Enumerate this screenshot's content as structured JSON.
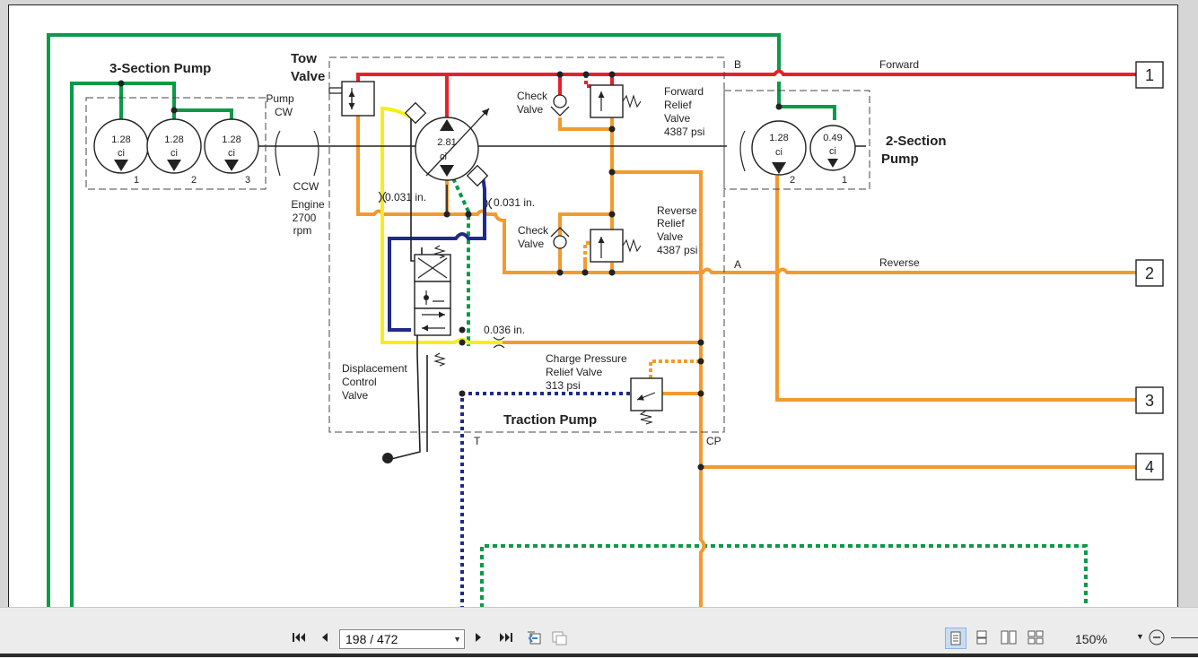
{
  "diagram": {
    "three_section_pump": {
      "title": "3-Section Pump",
      "sections": [
        {
          "value": "1.28",
          "unit": "ci",
          "num": "1"
        },
        {
          "value": "1.28",
          "unit": "ci",
          "num": "2"
        },
        {
          "value": "1.28",
          "unit": "ci",
          "num": "3"
        }
      ],
      "rotation_pump": [
        "Pump",
        "CW"
      ],
      "rotation_engine": [
        "CCW",
        "Engine",
        "2700",
        "rpm"
      ]
    },
    "tow_valve": [
      "Tow",
      "Valve"
    ],
    "traction_pump": {
      "title": "Traction Pump",
      "main": {
        "value": "2.81",
        "unit": "ci"
      },
      "orifice_1": "0.031 in.",
      "orifice_2": "0.031 in.",
      "orifice_3": "0.036 in.",
      "check_valve_1": [
        "Check",
        "Valve"
      ],
      "check_valve_2": [
        "Check",
        "Valve"
      ],
      "forward_relief": [
        "Forward",
        "Relief",
        "Valve",
        "4387 psi"
      ],
      "reverse_relief": [
        "Reverse",
        "Relief",
        "Valve",
        "4387 psi"
      ],
      "charge_relief": [
        "Charge Pressure",
        "Relief Valve",
        "313 psi"
      ],
      "displacement_valve": [
        "Displacement",
        "Control",
        "Valve"
      ],
      "port_b": "B",
      "port_a": "A",
      "port_t": "T",
      "port_cp": "CP"
    },
    "two_section_pump": {
      "title": [
        "2-Section",
        "Pump"
      ],
      "sections": [
        {
          "value": "1.28",
          "unit": "ci",
          "num": "2"
        },
        {
          "value": "0.49",
          "unit": "ci",
          "num": "1"
        }
      ]
    },
    "lines": {
      "forward": "Forward",
      "reverse": "Reverse"
    },
    "outputs": [
      "1",
      "2",
      "3",
      "4"
    ],
    "colors": {
      "green": "#0b9a48",
      "red": "#e8202a",
      "orange": "#f29a2e",
      "yellow": "#f6ee1c",
      "navy": "#1f2a8a",
      "black": "#222222"
    }
  },
  "toolbar": {
    "page_indicator": "198 / 472",
    "zoom": "150%",
    "icons": [
      "first-page-icon",
      "prev-page-icon",
      "next-page-icon",
      "last-page-icon",
      "go-back-icon",
      "go-forward-icon",
      "single-page-icon",
      "continuous-page-icon",
      "two-page-icon",
      "two-page-continuous-icon",
      "zoom-out-icon"
    ]
  }
}
